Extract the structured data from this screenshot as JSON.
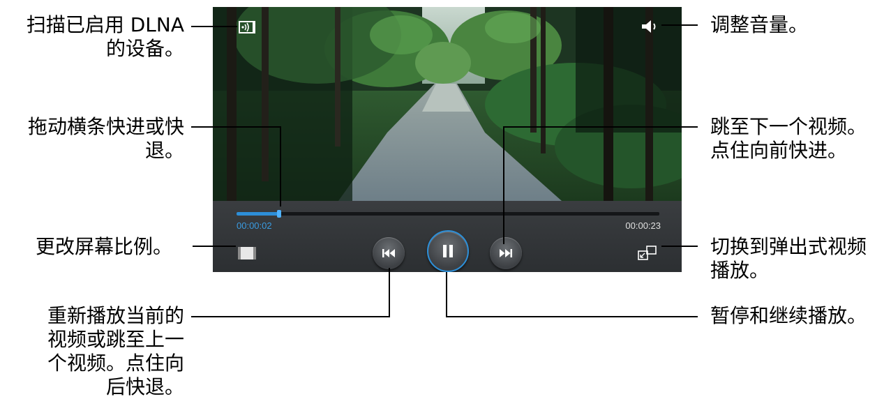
{
  "callouts": {
    "dlna": "扫描已启用 DLNA\n的设备。",
    "volume": "调整音量。",
    "seek": "拖动横条快进或快\n退。",
    "next": "跳至下一个视频。\n点住向前快进。",
    "ratio": "更改屏幕比例。",
    "popup": "切换到弹出式视频\n播放。",
    "previous": "重新播放当前的\n视频或跳至上一\n个视频。点住向\n后快退。",
    "pause": "暂停和继续播放。"
  },
  "player": {
    "elapsed_time": "00:00:02",
    "total_time": "00:00:23",
    "progress_fraction": 0.1
  },
  "icons": {
    "dlna": "dlna-icon",
    "volume": "volume-icon",
    "ratio": "screen-ratio-icon",
    "previous": "previous-icon",
    "pause": "pause-icon",
    "next": "next-icon",
    "popup": "popup-player-icon"
  },
  "colors": {
    "accent": "#2d8fd8",
    "leader_line": "#000000"
  }
}
